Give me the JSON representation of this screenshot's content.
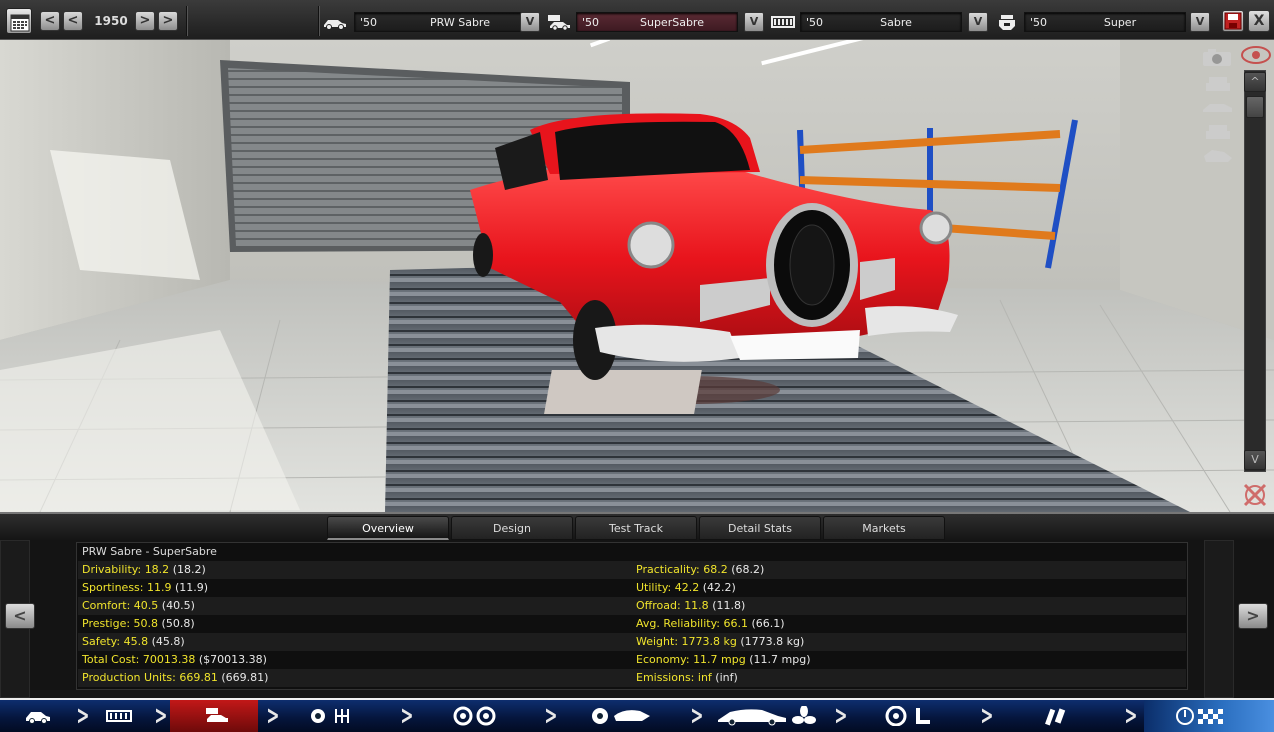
{
  "topbar": {
    "year": "1950",
    "prev_fast": "<",
    "prev": "<",
    "next": ">",
    "next_fast": ">",
    "selectors": [
      {
        "icon": "company-car-icon",
        "year": "'50",
        "name": "PRW Sabre",
        "dropdown": "V",
        "active": false
      },
      {
        "icon": "model-car-icon",
        "year": "'50",
        "name": "SuperSabre",
        "dropdown": "V",
        "active": true
      },
      {
        "icon": "chassis-icon",
        "year": "'50",
        "name": "Sabre",
        "dropdown": "V",
        "active": false
      },
      {
        "icon": "engine-icon",
        "year": "'50",
        "name": "Super",
        "dropdown": "V",
        "active": false
      }
    ],
    "close": "X"
  },
  "viewport": {
    "scroll_up": "^",
    "scroll_down": "V",
    "car_color": "#e8141c",
    "side_icons": [
      "camera-icon",
      "car-front-view-icon",
      "car-side-view-icon",
      "car-rear-view-icon",
      "car-angle-view-icon"
    ]
  },
  "tabs": [
    {
      "label": "Overview",
      "active": true
    },
    {
      "label": "Design",
      "active": false
    },
    {
      "label": "Test Track",
      "active": false
    },
    {
      "label": "Detail Stats",
      "active": false
    },
    {
      "label": "Markets",
      "active": false
    }
  ],
  "stats": {
    "title": "PRW Sabre - SuperSabre",
    "left": [
      {
        "label": "Drivability:",
        "value": "18.2",
        "paren": "(18.2)"
      },
      {
        "label": "Sportiness:",
        "value": "11.9",
        "paren": "(11.9)"
      },
      {
        "label": "Comfort:",
        "value": "40.5",
        "paren": "(40.5)"
      },
      {
        "label": "Prestige:",
        "value": "50.8",
        "paren": "(50.8)"
      },
      {
        "label": "Safety:",
        "value": "45.8",
        "paren": "(45.8)"
      },
      {
        "label": "Total Cost:",
        "value": "70013.38",
        "paren": "($70013.38)"
      },
      {
        "label": "Production Units:",
        "value": "669.81",
        "paren": "(669.81)"
      }
    ],
    "right": [
      {
        "label": "Practicality:",
        "value": "68.2",
        "paren": "(68.2)"
      },
      {
        "label": "Utility:",
        "value": "42.2",
        "paren": "(42.2)"
      },
      {
        "label": "Offroad:",
        "value": "11.8",
        "paren": "(11.8)"
      },
      {
        "label": "Avg. Reliability:",
        "value": "66.1",
        "paren": "(66.1)"
      },
      {
        "label": "Weight:",
        "value": "1773.8 kg",
        "paren": "(1773.8 kg)"
      },
      {
        "label": "Economy:",
        "value": "11.7 mpg",
        "paren": "(11.7 mpg)"
      },
      {
        "label": "Emissions:",
        "value": "inf",
        "paren": "(inf)"
      }
    ]
  },
  "panel_nav": {
    "prev": "<",
    "next": ">"
  },
  "bottomnav": {
    "steps": [
      {
        "icon": "car-icon",
        "active": false
      },
      {
        "icon": "chassis-frame-icon",
        "active": false
      },
      {
        "icon": "car-model-icon",
        "active": true
      },
      {
        "icon": "engine-gearbox-icon",
        "active": false
      },
      {
        "icon": "wheels-icon",
        "active": false
      },
      {
        "icon": "suspension-body-icon",
        "active": false
      },
      {
        "icon": "car-body-fan-icon",
        "active": false
      },
      {
        "icon": "steering-seat-icon",
        "active": false
      },
      {
        "icon": "tools-icon",
        "active": false
      },
      {
        "icon": "finish-flag-icon",
        "active": false
      }
    ]
  }
}
